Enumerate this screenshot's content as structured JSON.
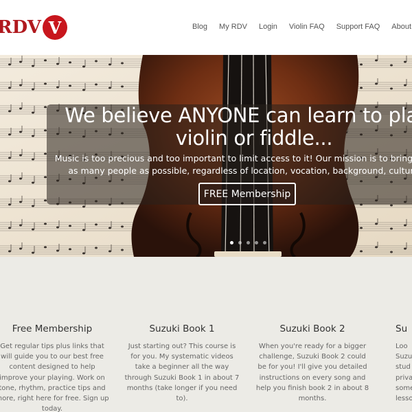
{
  "header": {
    "logo_text": "RDV",
    "logo_badge": "V",
    "nav": [
      "Blog",
      "My RDV",
      "Login",
      "Violin FAQ",
      "Support FAQ",
      "About Your"
    ]
  },
  "hero": {
    "title": "We believe ANYONE can learn to play t\nviolin or fiddle...",
    "subtitle": "Music is too precious and too important to limit access to it! Our mission is to bring the joy of m\nas many people as possible, regardless of location, vocation, background, culture, or abili",
    "cta_label": "FREE Membership",
    "slide_count": 5,
    "active_slide": 1
  },
  "features": [
    {
      "title": "Free Membership",
      "text": "Get regular tips plus links that will guide you to our best free content designed to help improve your playing. Work on tone, rhythm, practice tips and more, right here for free. Sign up today."
    },
    {
      "title": "Suzuki Book 1",
      "text": "Just starting out? This course is for you. My systematic videos take a beginner all the way through Suzuki Book 1 in about 7 months (take longer if you need to)."
    },
    {
      "title": "Suzuki Book 2",
      "text": "When you're ready for a bigger challenge, Suzuki Book 2 could be for you! I'll give you detailed instructions on every song and help you finish book 2 in about 8 months."
    },
    {
      "title": "Su",
      "text": "Loo\nSuzu\nstud\npriva\nsome\nlesson"
    }
  ]
}
